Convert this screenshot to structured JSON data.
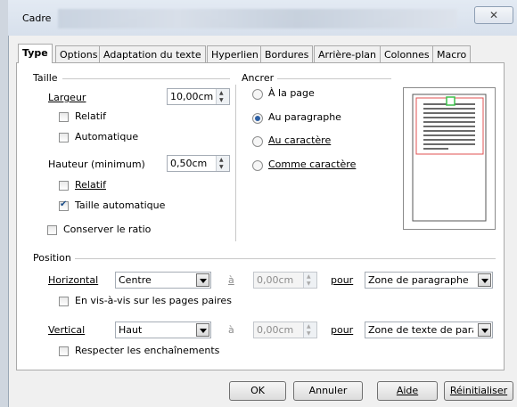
{
  "window": {
    "title": "Cadre",
    "close_glyph": "✕"
  },
  "tabs": [
    {
      "label": "Type",
      "active": true
    },
    {
      "label": "Options",
      "active": false
    },
    {
      "label": "Adaptation du texte",
      "active": false
    },
    {
      "label": "Hyperlien",
      "active": false
    },
    {
      "label": "Bordures",
      "active": false
    },
    {
      "label": "Arrière-plan",
      "active": false
    },
    {
      "label": "Colonnes",
      "active": false
    },
    {
      "label": "Macro",
      "active": false
    }
  ],
  "taille": {
    "group_label": "Taille",
    "largeur_label": "Largeur",
    "largeur_value": "10,00cm",
    "relatif_1_label": "Relatif",
    "relatif_1_checked": false,
    "automatique_label": "Automatique",
    "automatique_checked": false,
    "hauteur_label": "Hauteur (minimum)",
    "hauteur_value": "0,50cm",
    "relatif_2_label": "Relatif",
    "relatif_2_checked": false,
    "taille_auto_label": "Taille automatique",
    "taille_auto_checked": true,
    "conserver_ratio_label": "Conserver le ratio",
    "conserver_ratio_checked": false
  },
  "ancrer": {
    "group_label": "Ancrer",
    "options": [
      {
        "label": "À la page",
        "selected": false
      },
      {
        "label": "Au paragraphe",
        "selected": true
      },
      {
        "label": "Au caractère",
        "selected": false
      },
      {
        "label": "Comme caractère",
        "selected": false
      }
    ]
  },
  "position": {
    "group_label": "Position",
    "horizontal_label": "Horizontal",
    "horizontal_value": "Centre",
    "horizontal_a_label": "à",
    "horizontal_offset": "0,00cm",
    "horizontal_pour_label": "pour",
    "horizontal_pour_value": "Zone de paragraphe",
    "vis_a_vis_label": "En vis-à-vis sur les pages paires",
    "vis_a_vis_checked": false,
    "vertical_label": "Vertical",
    "vertical_value": "Haut",
    "vertical_a_label": "à",
    "vertical_offset": "0,00cm",
    "vertical_pour_label": "pour",
    "vertical_pour_value": "Zone de texte de para",
    "enchainements_label": "Respecter les enchaînements",
    "enchainements_checked": false
  },
  "buttons": {
    "ok": "OK",
    "annuler": "Annuler",
    "aide": "Aide",
    "reinitialiser": "Réinitialiser"
  },
  "colors": {
    "preview_frame": "#e05050",
    "preview_anchor": "#3cc04a"
  }
}
